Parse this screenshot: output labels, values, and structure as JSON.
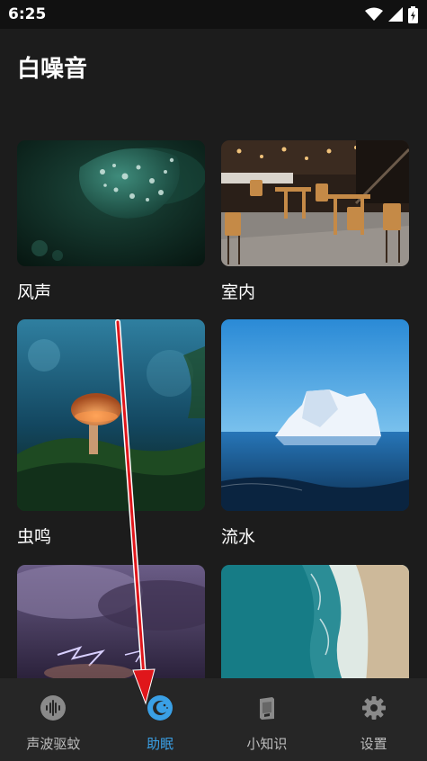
{
  "status_bar": {
    "time": "6:25"
  },
  "page": {
    "title": "白噪音"
  },
  "cards": [
    {
      "label": "风声",
      "image": "green-leaf-water-drops"
    },
    {
      "label": "室内",
      "image": "cafe-interior"
    },
    {
      "label": "虫鸣",
      "image": "glowing-mushroom-forest"
    },
    {
      "label": "流水",
      "image": "iceberg-in-sea"
    },
    {
      "label": "",
      "image": "purple-storm-lightning"
    },
    {
      "label": "",
      "image": "aerial-beach-waves"
    }
  ],
  "bottom_nav": {
    "items": [
      {
        "label": "声波驱蚊",
        "icon": "sound-wave-icon",
        "active": false
      },
      {
        "label": "助眠",
        "icon": "moon-stars-icon",
        "active": true
      },
      {
        "label": "小知识",
        "icon": "book-icon",
        "active": false
      },
      {
        "label": "设置",
        "icon": "gear-icon",
        "active": false
      }
    ]
  },
  "colors": {
    "accent": "#3aa0e6",
    "background": "#1c1c1c",
    "nav_background": "#262626",
    "annotation_arrow": "#e0161b"
  }
}
